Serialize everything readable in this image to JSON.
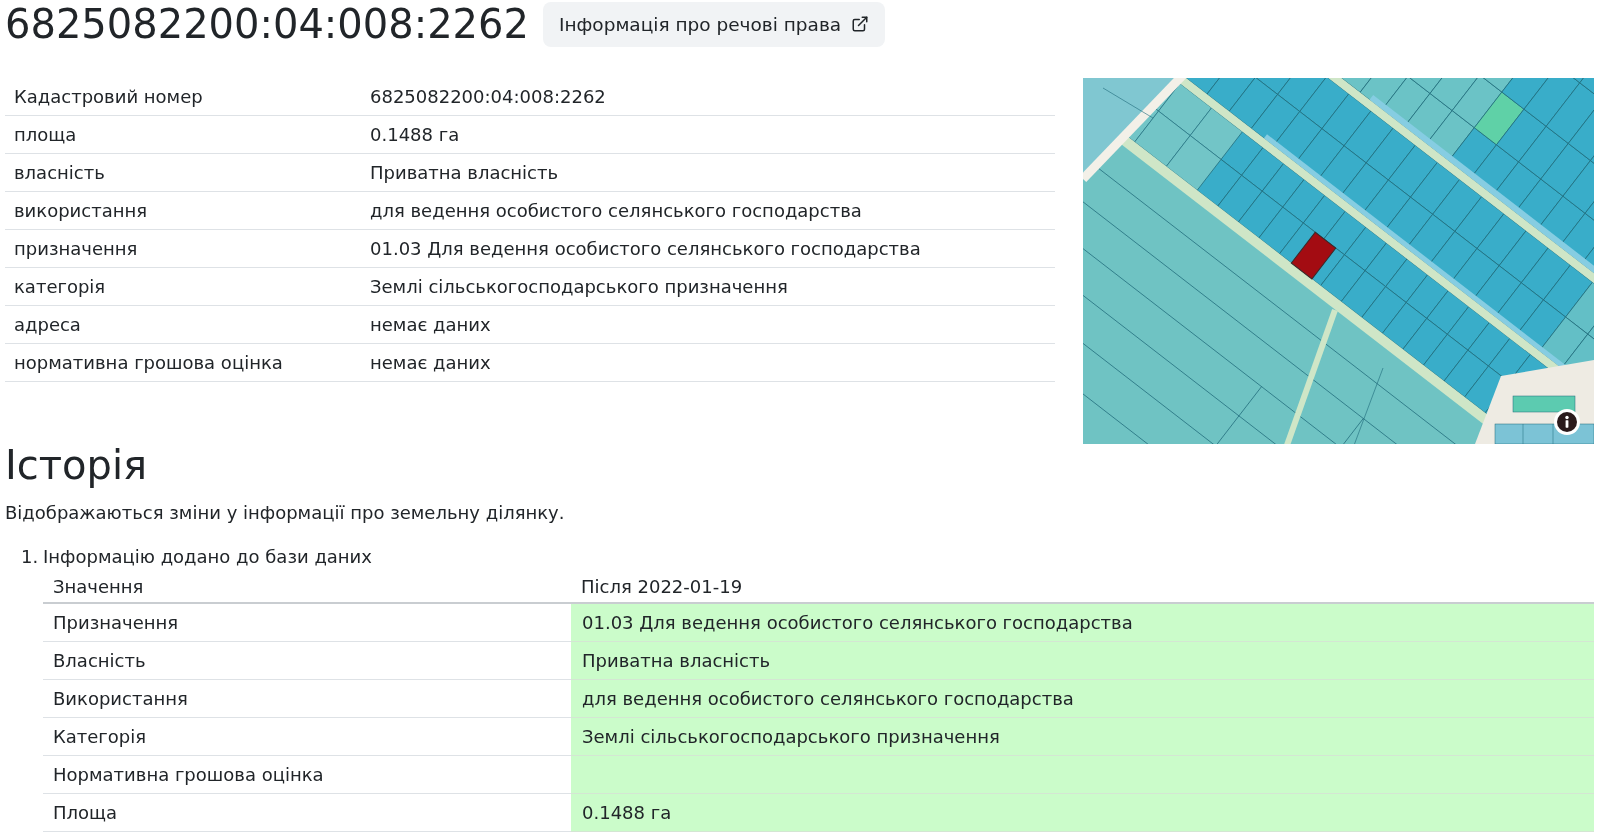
{
  "title": "6825082200:04:008:2262",
  "rights_button": {
    "label": "Інформація про речові права"
  },
  "details": [
    {
      "label": "Кадастровий номер",
      "value": "6825082200:04:008:2262"
    },
    {
      "label": "площа",
      "value": "0.1488 га"
    },
    {
      "label": "власність",
      "value": "Приватна власність"
    },
    {
      "label": "використання",
      "value": "для ведення особистого селянського господарства"
    },
    {
      "label": "призначення",
      "value": "01.03 Для ведення особистого селянського господарства"
    },
    {
      "label": "категорія",
      "value": "Землі сільськогосподарського призначення"
    },
    {
      "label": "адреса",
      "value": "немає даних"
    },
    {
      "label": "нормативна грошова оцінка",
      "value": "немає даних"
    }
  ],
  "history": {
    "title": "Історія",
    "description": "Відображаються зміни у інформації про земельну ділянку.",
    "entries": [
      {
        "number": "1.",
        "title": "Інформацію додано до бази даних",
        "columns": [
          "Значення",
          "Після 2022-01-19"
        ],
        "rows": [
          {
            "label": "Призначення",
            "value": "01.03 Для ведення особистого селянського господарства",
            "changed": true
          },
          {
            "label": "Власність",
            "value": "Приватна власність",
            "changed": true
          },
          {
            "label": "Використання",
            "value": "для ведення особистого селянського господарства",
            "changed": true
          },
          {
            "label": "Категорія",
            "value": "Землі сільськогосподарського призначення",
            "changed": true
          },
          {
            "label": "Нормативна грошова оцінка",
            "changed": true
          },
          {
            "label": "Площа",
            "value": "0.1488 га",
            "changed": true
          }
        ]
      }
    ]
  }
}
